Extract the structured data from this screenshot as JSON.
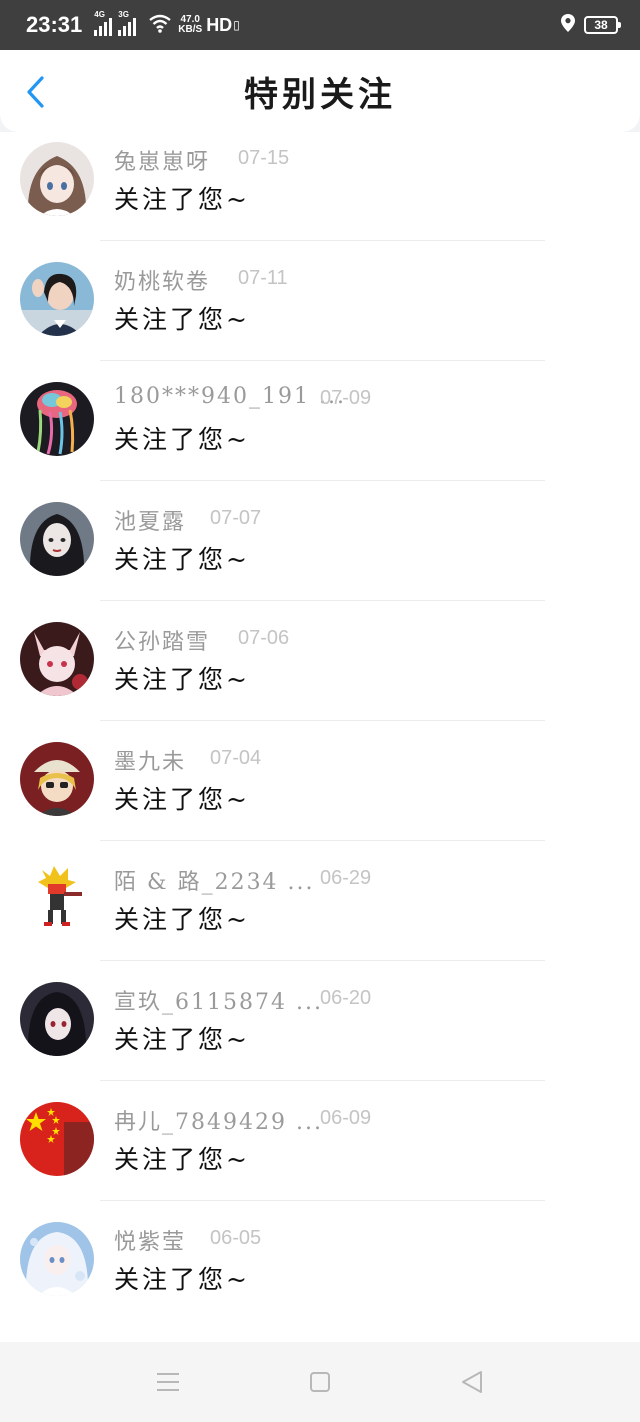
{
  "status_bar": {
    "time": "23:31",
    "sim1": "4G",
    "sim2": "3G",
    "speed_value": "47.0",
    "speed_unit": "KB/S",
    "hd": "HD",
    "battery": "38"
  },
  "header": {
    "title": "特别关注"
  },
  "items": [
    {
      "name": "兔崽崽呀",
      "date": "07-15",
      "message": "关注了您~",
      "avatar_icon": "avatar-anime-girl-brown-hair"
    },
    {
      "name": "奶桃软卷",
      "date": "07-11",
      "message": "关注了您~",
      "avatar_icon": "avatar-photo-girl-uniform"
    },
    {
      "name": "180***940_191 ...",
      "date": "07-09",
      "message": "关注了您~",
      "avatar_icon": "avatar-jellyfish"
    },
    {
      "name": "池夏露",
      "date": "07-07",
      "message": "关注了您~",
      "avatar_icon": "avatar-dark-hair-girl"
    },
    {
      "name": "公孙踏雪",
      "date": "07-06",
      "message": "关注了您~",
      "avatar_icon": "avatar-pink-cat-girl"
    },
    {
      "name": "墨九未",
      "date": "07-04",
      "message": "关注了您~",
      "avatar_icon": "avatar-blonde-cap-boy"
    },
    {
      "name": "陌 & 路_2234 ...",
      "date": "06-29",
      "message": "关注了您~",
      "avatar_icon": "avatar-pixel-character"
    },
    {
      "name": "宣玖_6115874 ...",
      "date": "06-20",
      "message": "关注了您~",
      "avatar_icon": "avatar-dark-anime-girl"
    },
    {
      "name": "冉儿_7849429 ...",
      "date": "06-09",
      "message": "关注了您~",
      "avatar_icon": "avatar-china-flag"
    },
    {
      "name": "悦紫莹",
      "date": "06-05",
      "message": "关注了您~",
      "avatar_icon": "avatar-white-hair-girl"
    }
  ],
  "colors": {
    "accent": "#2196f3",
    "name": "#9a9a9a",
    "date": "#c4c4c4",
    "message": "#111111"
  }
}
